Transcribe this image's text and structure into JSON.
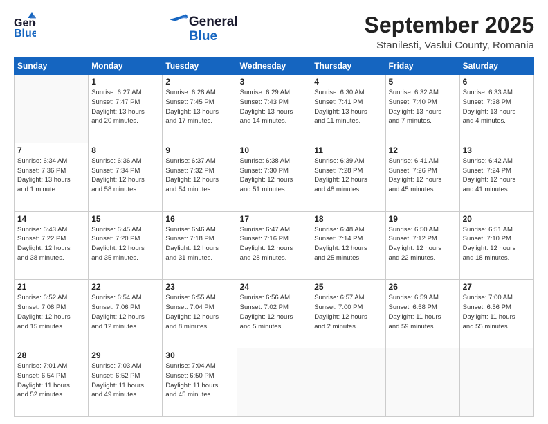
{
  "header": {
    "logo_general": "General",
    "logo_blue": "Blue",
    "month_title": "September 2025",
    "subtitle": "Stanilesti, Vaslui County, Romania"
  },
  "weekdays": [
    "Sunday",
    "Monday",
    "Tuesday",
    "Wednesday",
    "Thursday",
    "Friday",
    "Saturday"
  ],
  "weeks": [
    [
      {
        "day": "",
        "info": ""
      },
      {
        "day": "1",
        "info": "Sunrise: 6:27 AM\nSunset: 7:47 PM\nDaylight: 13 hours\nand 20 minutes."
      },
      {
        "day": "2",
        "info": "Sunrise: 6:28 AM\nSunset: 7:45 PM\nDaylight: 13 hours\nand 17 minutes."
      },
      {
        "day": "3",
        "info": "Sunrise: 6:29 AM\nSunset: 7:43 PM\nDaylight: 13 hours\nand 14 minutes."
      },
      {
        "day": "4",
        "info": "Sunrise: 6:30 AM\nSunset: 7:41 PM\nDaylight: 13 hours\nand 11 minutes."
      },
      {
        "day": "5",
        "info": "Sunrise: 6:32 AM\nSunset: 7:40 PM\nDaylight: 13 hours\nand 7 minutes."
      },
      {
        "day": "6",
        "info": "Sunrise: 6:33 AM\nSunset: 7:38 PM\nDaylight: 13 hours\nand 4 minutes."
      }
    ],
    [
      {
        "day": "7",
        "info": "Sunrise: 6:34 AM\nSunset: 7:36 PM\nDaylight: 13 hours\nand 1 minute."
      },
      {
        "day": "8",
        "info": "Sunrise: 6:36 AM\nSunset: 7:34 PM\nDaylight: 12 hours\nand 58 minutes."
      },
      {
        "day": "9",
        "info": "Sunrise: 6:37 AM\nSunset: 7:32 PM\nDaylight: 12 hours\nand 54 minutes."
      },
      {
        "day": "10",
        "info": "Sunrise: 6:38 AM\nSunset: 7:30 PM\nDaylight: 12 hours\nand 51 minutes."
      },
      {
        "day": "11",
        "info": "Sunrise: 6:39 AM\nSunset: 7:28 PM\nDaylight: 12 hours\nand 48 minutes."
      },
      {
        "day": "12",
        "info": "Sunrise: 6:41 AM\nSunset: 7:26 PM\nDaylight: 12 hours\nand 45 minutes."
      },
      {
        "day": "13",
        "info": "Sunrise: 6:42 AM\nSunset: 7:24 PM\nDaylight: 12 hours\nand 41 minutes."
      }
    ],
    [
      {
        "day": "14",
        "info": "Sunrise: 6:43 AM\nSunset: 7:22 PM\nDaylight: 12 hours\nand 38 minutes."
      },
      {
        "day": "15",
        "info": "Sunrise: 6:45 AM\nSunset: 7:20 PM\nDaylight: 12 hours\nand 35 minutes."
      },
      {
        "day": "16",
        "info": "Sunrise: 6:46 AM\nSunset: 7:18 PM\nDaylight: 12 hours\nand 31 minutes."
      },
      {
        "day": "17",
        "info": "Sunrise: 6:47 AM\nSunset: 7:16 PM\nDaylight: 12 hours\nand 28 minutes."
      },
      {
        "day": "18",
        "info": "Sunrise: 6:48 AM\nSunset: 7:14 PM\nDaylight: 12 hours\nand 25 minutes."
      },
      {
        "day": "19",
        "info": "Sunrise: 6:50 AM\nSunset: 7:12 PM\nDaylight: 12 hours\nand 22 minutes."
      },
      {
        "day": "20",
        "info": "Sunrise: 6:51 AM\nSunset: 7:10 PM\nDaylight: 12 hours\nand 18 minutes."
      }
    ],
    [
      {
        "day": "21",
        "info": "Sunrise: 6:52 AM\nSunset: 7:08 PM\nDaylight: 12 hours\nand 15 minutes."
      },
      {
        "day": "22",
        "info": "Sunrise: 6:54 AM\nSunset: 7:06 PM\nDaylight: 12 hours\nand 12 minutes."
      },
      {
        "day": "23",
        "info": "Sunrise: 6:55 AM\nSunset: 7:04 PM\nDaylight: 12 hours\nand 8 minutes."
      },
      {
        "day": "24",
        "info": "Sunrise: 6:56 AM\nSunset: 7:02 PM\nDaylight: 12 hours\nand 5 minutes."
      },
      {
        "day": "25",
        "info": "Sunrise: 6:57 AM\nSunset: 7:00 PM\nDaylight: 12 hours\nand 2 minutes."
      },
      {
        "day": "26",
        "info": "Sunrise: 6:59 AM\nSunset: 6:58 PM\nDaylight: 11 hours\nand 59 minutes."
      },
      {
        "day": "27",
        "info": "Sunrise: 7:00 AM\nSunset: 6:56 PM\nDaylight: 11 hours\nand 55 minutes."
      }
    ],
    [
      {
        "day": "28",
        "info": "Sunrise: 7:01 AM\nSunset: 6:54 PM\nDaylight: 11 hours\nand 52 minutes."
      },
      {
        "day": "29",
        "info": "Sunrise: 7:03 AM\nSunset: 6:52 PM\nDaylight: 11 hours\nand 49 minutes."
      },
      {
        "day": "30",
        "info": "Sunrise: 7:04 AM\nSunset: 6:50 PM\nDaylight: 11 hours\nand 45 minutes."
      },
      {
        "day": "",
        "info": ""
      },
      {
        "day": "",
        "info": ""
      },
      {
        "day": "",
        "info": ""
      },
      {
        "day": "",
        "info": ""
      }
    ]
  ]
}
